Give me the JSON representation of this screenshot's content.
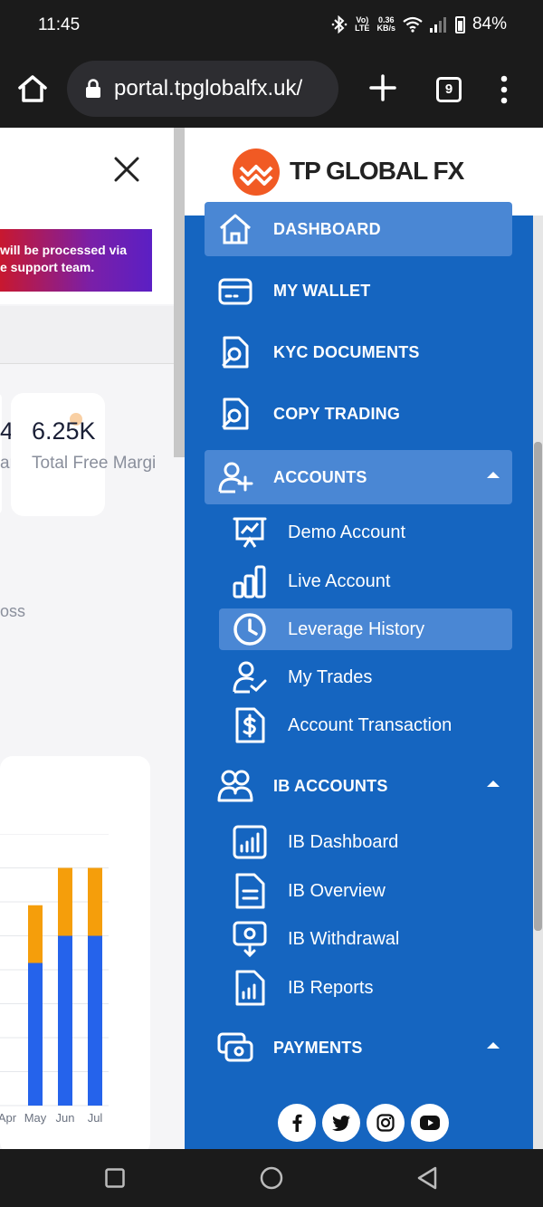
{
  "status_bar": {
    "time": "11:45",
    "net_top": "Vo)",
    "net_bottom": "LTE",
    "speed_top": "0.36",
    "speed_bottom": "KB/s",
    "battery": "84%"
  },
  "browser": {
    "url": "portal.tpglobalfx.uk/",
    "tab_count": "9"
  },
  "background_page": {
    "promo_line1": "will be processed via",
    "promo_line2": "e support team.",
    "stat_left_value": "4",
    "stat_left_label": "ar",
    "stat_value": "6.25K",
    "stat_label": "Total Free Margi",
    "loss_label": "oss",
    "chart_months": [
      "Apr",
      "May",
      "Jun",
      "Jul"
    ]
  },
  "chart_data": {
    "type": "bar",
    "stacked": true,
    "categories": [
      "Apr",
      "May",
      "Jun",
      "Jul"
    ],
    "series": [
      {
        "color": "#2563eb",
        "values": [
          0,
          42,
          50,
          50
        ]
      },
      {
        "color": "#f59e0b",
        "values": [
          0,
          17,
          20,
          20
        ]
      }
    ],
    "ylim": [
      0,
      80
    ],
    "grid": true
  },
  "sidebar": {
    "logo_text": "TP GLOBAL FX",
    "nav": [
      {
        "label": "DASHBOARD"
      },
      {
        "label": "MY WALLET"
      },
      {
        "label": "KYC DOCUMENTS"
      },
      {
        "label": "COPY TRADING"
      },
      {
        "label": "ACCOUNTS"
      }
    ],
    "accounts_sub": [
      {
        "label": "Demo Account"
      },
      {
        "label": "Live Account"
      },
      {
        "label": "Leverage History"
      },
      {
        "label": "My Trades"
      },
      {
        "label": "Account Transaction"
      }
    ],
    "ib_label": "IB ACCOUNTS",
    "ib_sub": [
      {
        "label": "IB Dashboard"
      },
      {
        "label": "IB Overview"
      },
      {
        "label": "IB Withdrawal"
      },
      {
        "label": "IB Reports"
      }
    ],
    "payments_label": "PAYMENTS",
    "social": [
      "facebook-icon",
      "twitter-icon",
      "instagram-icon",
      "youtube-icon"
    ]
  }
}
